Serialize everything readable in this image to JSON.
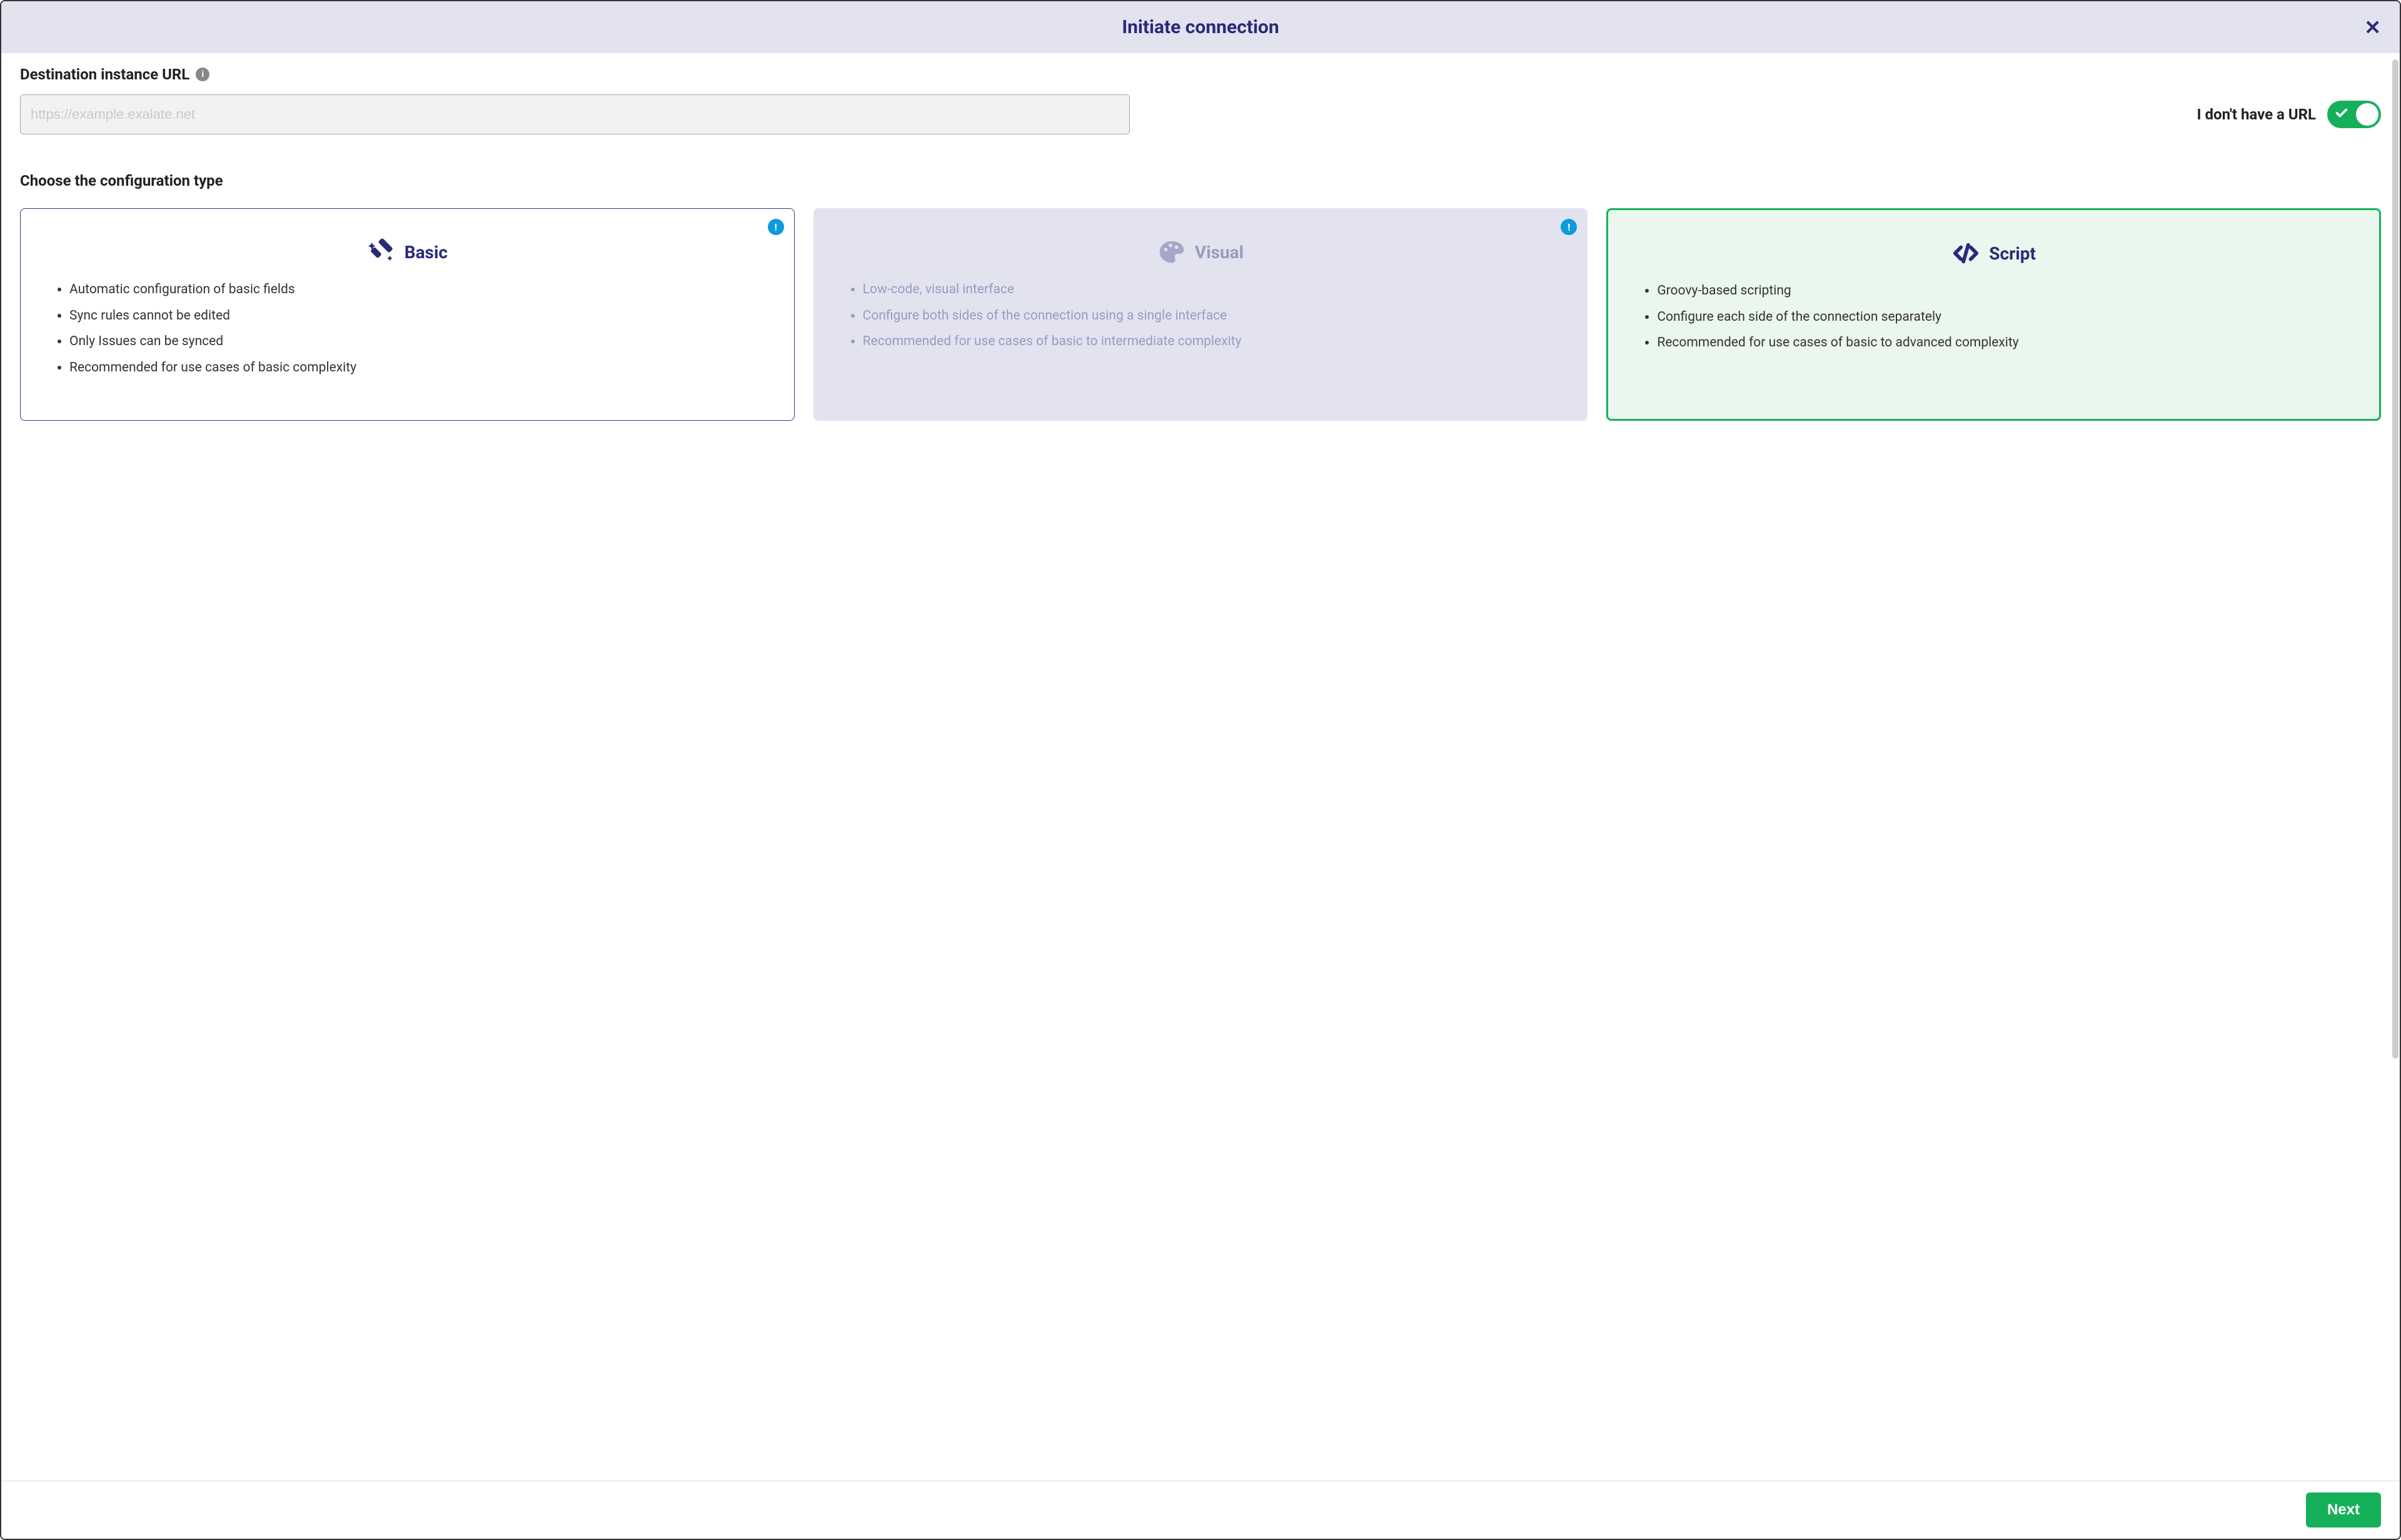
{
  "modal": {
    "title": "Initiate connection"
  },
  "url_field": {
    "label": "Destination instance URL",
    "placeholder": "https://example.exalate.net",
    "value": ""
  },
  "toggle": {
    "label": "I don't have a URL",
    "on": true
  },
  "config_section": {
    "label": "Choose the configuration type"
  },
  "cards": {
    "basic": {
      "title": "Basic",
      "items": [
        "Automatic configuration of basic fields",
        "Sync rules cannot be edited",
        "Only Issues can be synced",
        "Recommended for use cases of basic complexity"
      ]
    },
    "visual": {
      "title": "Visual",
      "items": [
        "Low-code, visual interface",
        "Configure both sides of the connection using a single interface",
        "Recommended for use cases of basic to intermediate complexity"
      ]
    },
    "script": {
      "title": "Script",
      "items": [
        "Groovy-based scripting",
        "Configure each side of the connection separately",
        "Recommended for use cases of basic to advanced complexity"
      ]
    }
  },
  "footer": {
    "next": "Next"
  }
}
